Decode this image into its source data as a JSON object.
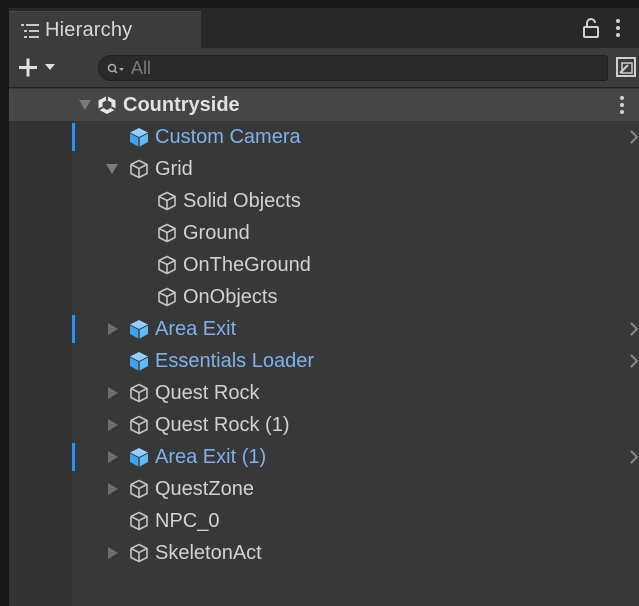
{
  "window": {
    "tab_title": "Hierarchy",
    "tab_icon": "list-icon"
  },
  "toolbar": {
    "add_label": "+",
    "search_placeholder": "All",
    "search_value": ""
  },
  "colors": {
    "panel_bg": "#383838",
    "prefab_text": "#7cb2ee",
    "text": "#d2d2d2",
    "modified_bar": "#3b8fd6",
    "selected_scene_bg": "#464646"
  },
  "tree": {
    "scene": {
      "label": "Countryside",
      "icon": "unity-scene-icon",
      "expanded": true
    },
    "items": [
      {
        "label": "Custom Camera",
        "icon": "prefab-cube-icon",
        "prefab": true,
        "depth": 1,
        "arrow": "none",
        "modified": true,
        "has_chevron": true
      },
      {
        "label": "Grid",
        "icon": "cube-outline-icon",
        "prefab": false,
        "depth": 1,
        "arrow": "down",
        "modified": false,
        "has_chevron": false
      },
      {
        "label": "Solid Objects",
        "icon": "cube-outline-icon",
        "prefab": false,
        "depth": 2,
        "arrow": "none",
        "modified": false,
        "has_chevron": false
      },
      {
        "label": "Ground",
        "icon": "cube-outline-icon",
        "prefab": false,
        "depth": 2,
        "arrow": "none",
        "modified": false,
        "has_chevron": false
      },
      {
        "label": "OnTheGround",
        "icon": "cube-outline-icon",
        "prefab": false,
        "depth": 2,
        "arrow": "none",
        "modified": false,
        "has_chevron": false
      },
      {
        "label": "OnObjects",
        "icon": "cube-outline-icon",
        "prefab": false,
        "depth": 2,
        "arrow": "none",
        "modified": false,
        "has_chevron": false
      },
      {
        "label": "Area Exit",
        "icon": "prefab-cube-icon",
        "prefab": true,
        "depth": 1,
        "arrow": "right",
        "modified": true,
        "has_chevron": true
      },
      {
        "label": "Essentials Loader",
        "icon": "prefab-cube-icon",
        "prefab": true,
        "depth": 1,
        "arrow": "none",
        "modified": false,
        "has_chevron": true
      },
      {
        "label": "Quest Rock",
        "icon": "cube-outline-icon",
        "prefab": false,
        "depth": 1,
        "arrow": "right",
        "modified": false,
        "has_chevron": false
      },
      {
        "label": "Quest Rock (1)",
        "icon": "cube-outline-icon",
        "prefab": false,
        "depth": 1,
        "arrow": "right",
        "modified": false,
        "has_chevron": false
      },
      {
        "label": "Area Exit (1)",
        "icon": "prefab-cube-icon",
        "prefab": true,
        "depth": 1,
        "arrow": "right",
        "modified": true,
        "has_chevron": true
      },
      {
        "label": "QuestZone",
        "icon": "cube-outline-icon",
        "prefab": false,
        "depth": 1,
        "arrow": "right",
        "modified": false,
        "has_chevron": false
      },
      {
        "label": "NPC_0",
        "icon": "cube-outline-icon",
        "prefab": false,
        "depth": 1,
        "arrow": "none",
        "modified": false,
        "has_chevron": false
      },
      {
        "label": "SkeletonAct",
        "icon": "cube-outline-icon",
        "prefab": false,
        "depth": 1,
        "arrow": "right",
        "modified": false,
        "has_chevron": false
      }
    ]
  }
}
